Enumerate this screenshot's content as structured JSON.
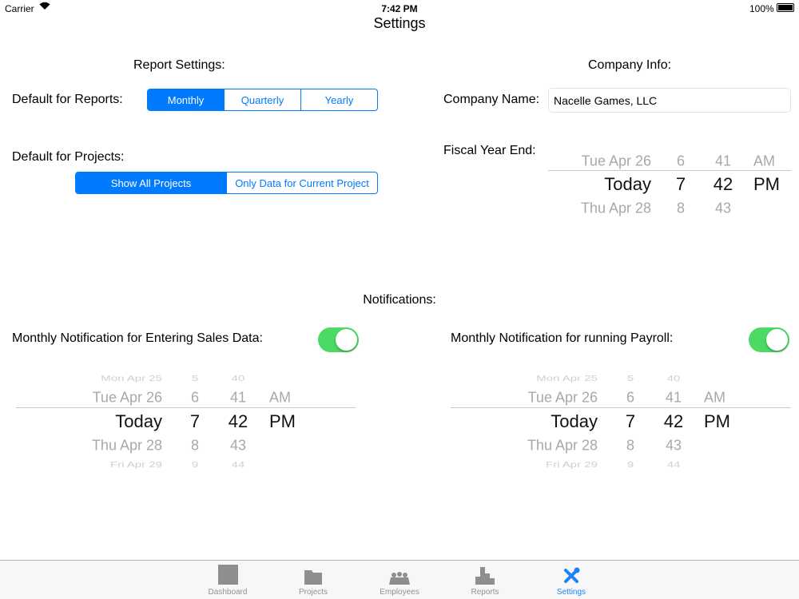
{
  "status_bar": {
    "carrier": "Carrier",
    "time": "7:42 PM",
    "battery": "100%"
  },
  "nav": {
    "title": "Settings"
  },
  "report_settings": {
    "heading": "Report Settings:",
    "reports_label": "Default for Reports:",
    "reports_options": [
      "Monthly",
      "Quarterly",
      "Yearly"
    ],
    "reports_selected": "Monthly",
    "projects_label": "Default for Projects:",
    "projects_options": [
      "Show All Projects",
      "Only Data for Current Project"
    ],
    "projects_selected": "Show All Projects"
  },
  "company_info": {
    "heading": "Company Info:",
    "name_label": "Company Name:",
    "name_value": "Nacelle Games, LLC",
    "fiscal_label": "Fiscal Year End:",
    "fiscal_picker": {
      "rows": [
        [
          "Tue Apr 26",
          "6",
          "41",
          "AM"
        ],
        [
          "Today",
          "7",
          "42",
          "PM"
        ],
        [
          "Thu Apr 28",
          "8",
          "43",
          ""
        ]
      ],
      "selected_index": 1
    }
  },
  "notifications": {
    "heading": "Notifications:",
    "sales": {
      "label": "Monthly Notification for Entering Sales Data:",
      "enabled": true,
      "picker": {
        "rows": [
          [
            "Mon Apr 25",
            "5",
            "40",
            ""
          ],
          [
            "Tue Apr 26",
            "6",
            "41",
            "AM"
          ],
          [
            "Today",
            "7",
            "42",
            "PM"
          ],
          [
            "Thu Apr 28",
            "8",
            "43",
            ""
          ],
          [
            "Fri Apr 29",
            "9",
            "44",
            ""
          ]
        ],
        "selected_index": 2
      }
    },
    "payroll": {
      "label": "Monthly Notification for running Payroll:",
      "enabled": true,
      "picker": {
        "rows": [
          [
            "Mon Apr 25",
            "5",
            "40",
            ""
          ],
          [
            "Tue Apr 26",
            "6",
            "41",
            "AM"
          ],
          [
            "Today",
            "7",
            "42",
            "PM"
          ],
          [
            "Thu Apr 28",
            "8",
            "43",
            ""
          ],
          [
            "Fri Apr 29",
            "9",
            "44",
            ""
          ]
        ],
        "selected_index": 2
      }
    }
  },
  "tab_bar": {
    "items": [
      {
        "label": "Dashboard",
        "icon": "dashboard-icon"
      },
      {
        "label": "Projects",
        "icon": "folder-icon"
      },
      {
        "label": "Employees",
        "icon": "people-icon"
      },
      {
        "label": "Reports",
        "icon": "reports-icon"
      },
      {
        "label": "Settings",
        "icon": "wrench-screwdriver-icon"
      }
    ],
    "active": "Settings"
  },
  "colors": {
    "accent": "#007aff",
    "toggle_on": "#4cd964",
    "tab_inactive": "#929292"
  }
}
